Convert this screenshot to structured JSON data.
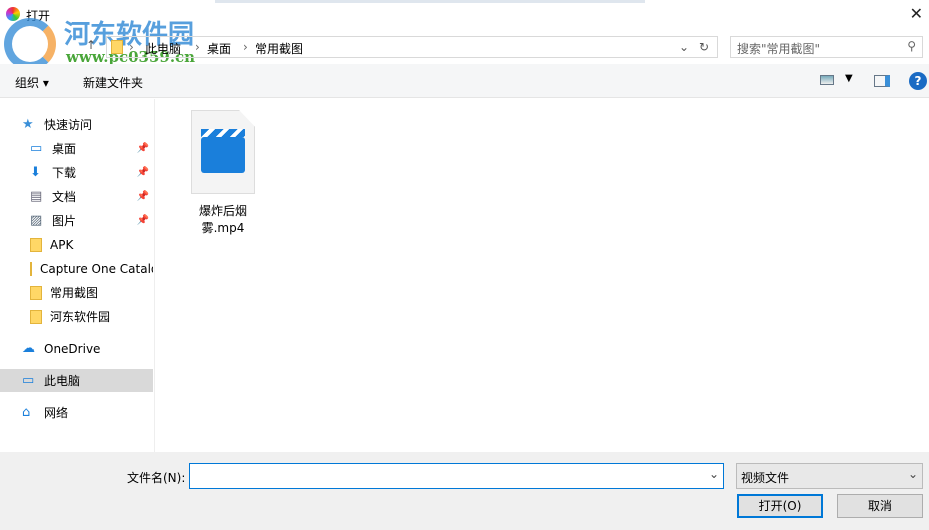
{
  "window": {
    "title": "打开",
    "close_icon": "close-icon"
  },
  "watermark": {
    "name": "河东软件园",
    "url": "www.pc0359.cn"
  },
  "address": {
    "crumbs": [
      "此电脑",
      "桌面",
      "常用截图"
    ]
  },
  "search": {
    "placeholder": "搜索\"常用截图\""
  },
  "toolbar": {
    "organize": "组织",
    "new_folder": "新建文件夹"
  },
  "sidebar": {
    "items": [
      {
        "label": "快速访问",
        "icon": "star-icon",
        "pinned": false
      },
      {
        "label": "桌面",
        "icon": "desktop-icon",
        "pinned": true
      },
      {
        "label": "下载",
        "icon": "download-icon",
        "pinned": true
      },
      {
        "label": "文档",
        "icon": "document-icon",
        "pinned": true
      },
      {
        "label": "图片",
        "icon": "picture-icon",
        "pinned": true
      },
      {
        "label": "APK",
        "icon": "folder-icon",
        "pinned": false
      },
      {
        "label": "Capture One Catalog",
        "icon": "folder-icon",
        "pinned": false
      },
      {
        "label": "常用截图",
        "icon": "folder-icon",
        "pinned": false
      },
      {
        "label": "河东软件园",
        "icon": "folder-icon",
        "pinned": false
      },
      {
        "label": "OneDrive",
        "icon": "cloud-icon",
        "pinned": false
      },
      {
        "label": "此电脑",
        "icon": "computer-icon",
        "pinned": false,
        "selected": true
      },
      {
        "label": "网络",
        "icon": "network-icon",
        "pinned": false
      }
    ]
  },
  "files": [
    {
      "name": "爆炸后烟雾.mp4",
      "icon": "video-file-icon"
    }
  ],
  "footer": {
    "filename_label": "文件名(N):",
    "filename_value": "",
    "filetype": "视频文件",
    "open": "打开(O)",
    "cancel": "取消"
  }
}
